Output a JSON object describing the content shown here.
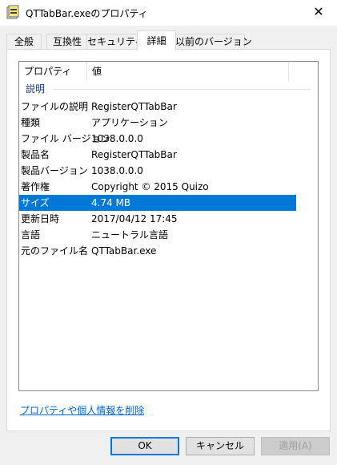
{
  "window": {
    "title": "QTTabBar.exeのプロパティ",
    "close_glyph": "✕"
  },
  "tabs": [
    {
      "label": "全般"
    },
    {
      "label": "互換性"
    },
    {
      "label": "セキュリティ"
    },
    {
      "label": "詳細",
      "active": true
    },
    {
      "label": "以前のバージョン"
    }
  ],
  "details": {
    "columns": {
      "property": "プロパティ",
      "value": "値"
    },
    "group_label": "説明",
    "rows": [
      {
        "key": "ファイルの説明",
        "value": "RegisterQTTabBar"
      },
      {
        "key": "種類",
        "value": "アプリケーション"
      },
      {
        "key": "ファイル バージョン",
        "value": "1038.0.0.0"
      },
      {
        "key": "製品名",
        "value": "RegisterQTTabBar"
      },
      {
        "key": "製品バージョン",
        "value": "1038.0.0.0"
      },
      {
        "key": "著作権",
        "value": "Copyright © 2015 Quizo"
      },
      {
        "key": "サイズ",
        "value": "4.74 MB",
        "selected": true
      },
      {
        "key": "更新日時",
        "value": "2017/04/12 17:45"
      },
      {
        "key": "言語",
        "value": "ニュートラル言語"
      },
      {
        "key": "元のファイル名",
        "value": "QTTabBar.exe"
      }
    ]
  },
  "remove_link": "プロパティや個人情報を削除",
  "buttons": {
    "ok": "OK",
    "cancel": "キャンセル",
    "apply": "適用(A)"
  },
  "colors": {
    "selection": "#0078d7",
    "link": "#0066cc",
    "group": "#1e3287"
  }
}
